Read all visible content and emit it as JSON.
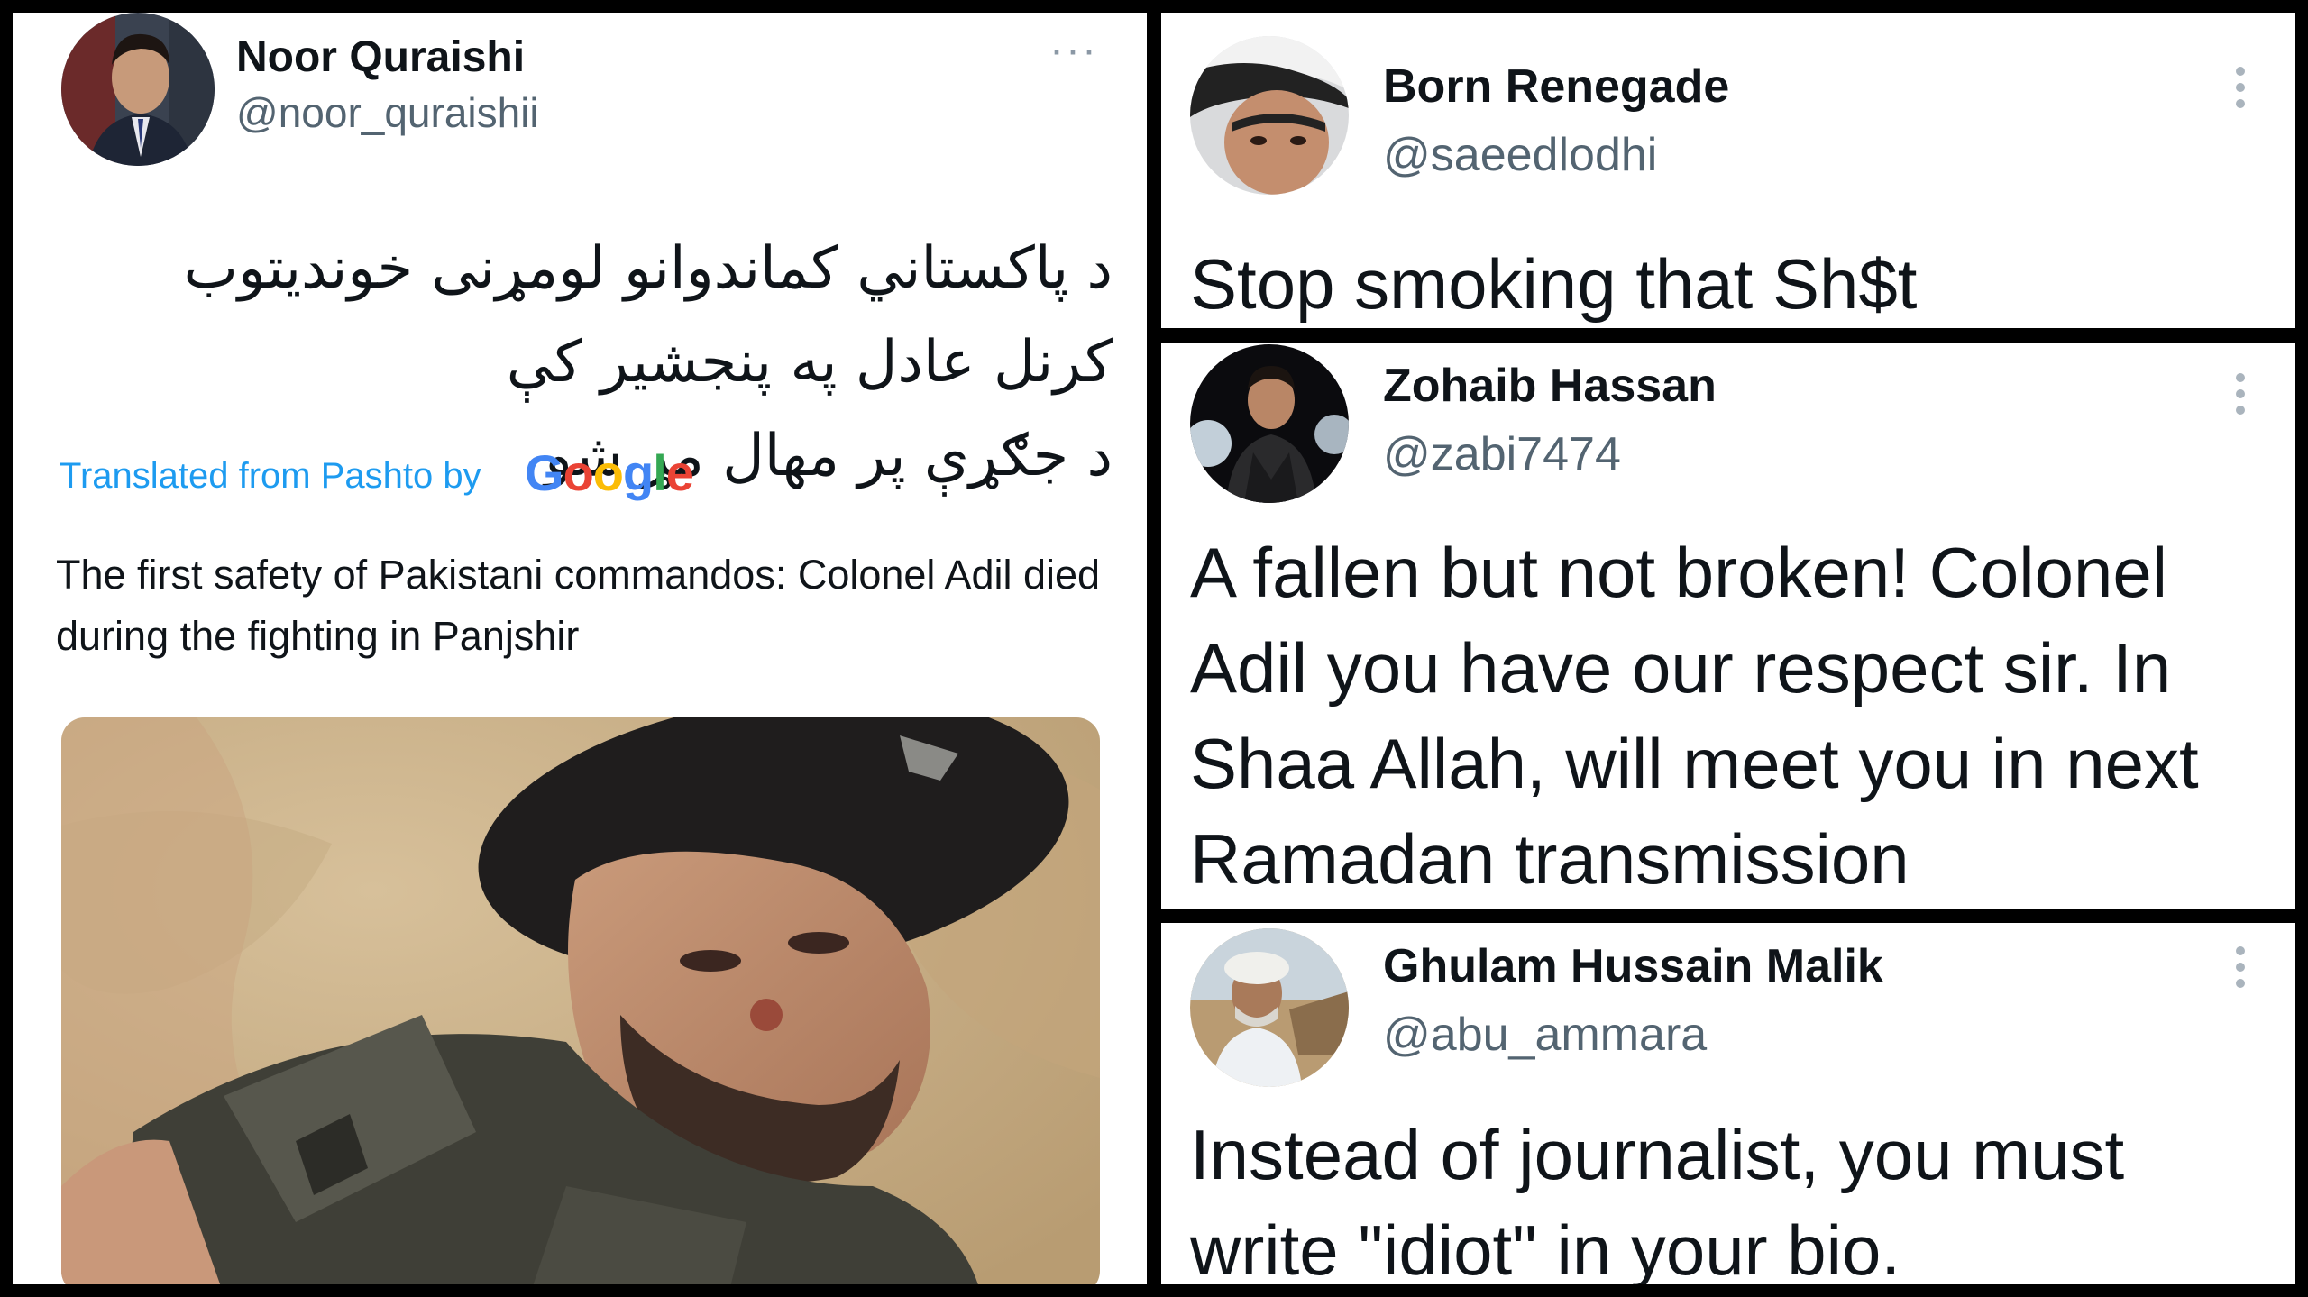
{
  "main_tweet": {
    "author_name": "Noor Quraishi",
    "author_handle": "@noor_quraishii",
    "more_label": "···",
    "original_text_line1": "د پاکستاني کماندوانو لومړنی خوندیتوب کرنل عادل په پنجشیر کې",
    "original_text_line2": "د جګړې پر مهال مړ شو",
    "translated_label": "Translated from Pashto by",
    "google_letters": [
      "G",
      "o",
      "o",
      "g",
      "l",
      "e"
    ],
    "google_colors": [
      "#4285F4",
      "#EA4335",
      "#FBBC05",
      "#4285F4",
      "#34A853",
      "#EA4335"
    ],
    "translation_text": "The first safety of Pakistani commandos: Colonel Adil died during the fighting in Panjshir"
  },
  "replies": [
    {
      "author_name": "Born Renegade",
      "author_handle": "@saeedlodhi",
      "text": "Stop smoking that Sh$t"
    },
    {
      "author_name": "Zohaib Hassan",
      "author_handle": "@zabi7474",
      "text": "A fallen but not broken! Colonel Adil you have our respect sir. In Shaa Allah, will meet you in next Ramadan transmission"
    },
    {
      "author_name": "Ghulam Hussain Malik",
      "author_handle": "@abu_ammara",
      "text": "Instead of journalist, you must write \"idiot\" in your bio."
    }
  ],
  "colors": {
    "link_blue": "#1d9bf0",
    "handle_gray": "#536471",
    "text_dark": "#0f1419",
    "background_black": "#000000"
  }
}
